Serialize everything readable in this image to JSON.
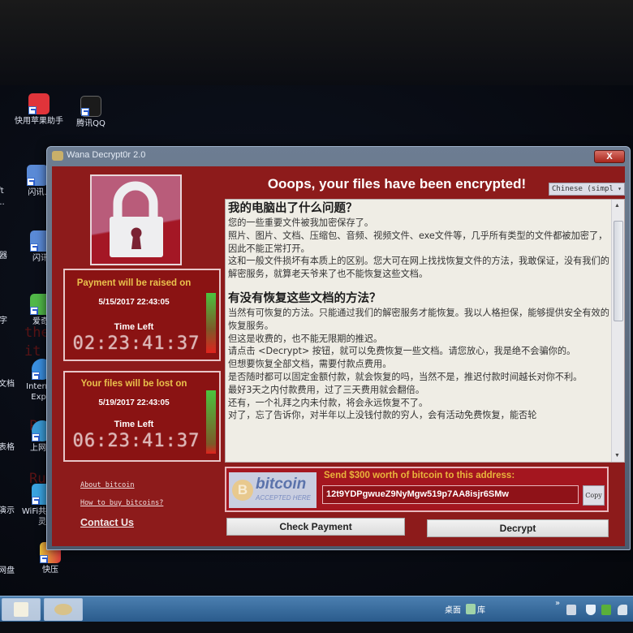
{
  "desktop": {
    "icons": [
      {
        "label": "快用苹果助手",
        "color": "#e0343a"
      },
      {
        "label": "腾讯QQ",
        "color": "#ffffff"
      },
      {
        "label": "闪讯.",
        "color": "#5a8ad6"
      },
      {
        "label": "闪讯",
        "color": "#5a8ad6"
      },
      {
        "label": "爱奇",
        "color": "#51b848"
      },
      {
        "label": "Internet Explo",
        "color": "#3a8fe0"
      },
      {
        "label": "上网导",
        "color": "#3a9ad6"
      },
      {
        "label": "WiFi共享精灵",
        "color": "#3aa3e0"
      },
      {
        "label": "快压",
        "color": "#e8c03a"
      }
    ],
    "left_edge_labels": [
      "oft",
      "o...",
      "器",
      "字",
      "文档",
      "表格",
      "演示",
      "网盘"
    ],
    "background_text": [
      "the",
      "it",
      "P",
      "Ru"
    ]
  },
  "window": {
    "title": "Wana Decrypt0r 2.0",
    "close_label": "X",
    "headline": "Ooops, your files have been encrypted!",
    "language": {
      "selected": "Chinese (simpl",
      "arrow": "▾"
    },
    "message": {
      "heading1": "我的电脑出了什么问题？",
      "para1": [
        "您的一些重要文件被我加密保存了。",
        "照片、图片、文档、压缩包、音频、视频文件、exe文件等，几乎所有类型的文件都被加密了，因此不能正常打开。",
        "这和一般文件损坏有本质上的区别。您大可在网上找找恢复文件的方法，我敢保证，没有我们的解密服务，就算老天爷来了也不能恢复这些文档。"
      ],
      "heading2": "有没有恢复这些文档的方法？",
      "para2": [
        "当然有可恢复的方法。只能通过我们的解密服务才能恢复。我以人格担保，能够提供安全有效的恢复服务。",
        "但这是收费的，也不能无限期的推迟。",
        "请点击 <Decrypt> 按钮，就可以免费恢复一些文档。请您放心，我是绝不会骗你的。",
        "但想要恢复全部文档，需要付款点费用。",
        "是否随时都可以固定金额付款，就会恢复的吗，当然不是，推迟付款时间越长对你不利。",
        "最好3天之内付款费用，过了三天费用就会翻倍。",
        "还有，一个礼拜之内未付款，将会永远恢复不了。",
        "对了，忘了告诉你，对半年以上没钱付款的穷人，会有活动免费恢复，能否轮"
      ]
    },
    "timers": [
      {
        "title": "Payment will be raised on",
        "date": "5/15/2017 22:43:05",
        "time_left_label": "Time Left",
        "countdown": "02:23:41:37",
        "remaining_fraction": 0.6
      },
      {
        "title": "Your files will be lost on",
        "date": "5/19/2017 22:43:05",
        "time_left_label": "Time Left",
        "countdown": "06:23:41:37",
        "remaining_fraction": 0.85
      }
    ],
    "links": {
      "about_bitcoin": "About bitcoin",
      "how_to_buy": "How to buy bitcoins?",
      "contact_us": "Contact Us"
    },
    "payment": {
      "badge_word": "bitcoin",
      "badge_sub": "ACCEPTED HERE",
      "badge_symbol": "B",
      "instruction": "Send $300 worth of bitcoin to this address:",
      "address": "12t9YDPgwueZ9NyMgw519p7AA8isjr6SMw",
      "copy_label": "Copy"
    },
    "buttons": {
      "check_payment": "Check Payment",
      "decrypt": "Decrypt"
    }
  },
  "taskbar": {
    "desktop_label": "桌面",
    "library_label": "库",
    "overflow": "»"
  },
  "colors": {
    "window_red": "#8d1b1b",
    "title_yellow": "#e9c14c",
    "send_orange": "#e9b43c"
  }
}
